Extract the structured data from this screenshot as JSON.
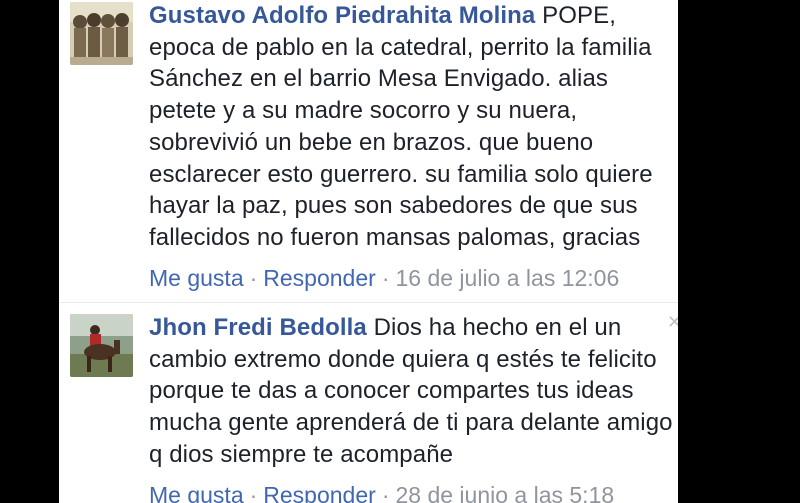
{
  "comments": [
    {
      "author": "Gustavo Adolfo Piedrahita Molina",
      "text": " POPE, epoca de pablo en la catedral, perrito la familia Sánchez en el barrio Mesa Envigado. alias petete y a su madre socorro y su nuera, sobrevivió un bebe en brazos. que bueno esclarecer esto guerrero. su familia solo quiere hayar la paz, pues son sabedores de que sus fallecidos no fueron mansas palomas, gracias",
      "like_label": "Me gusta",
      "reply_label": "Responder",
      "timestamp": "16 de julio a las 12:06"
    },
    {
      "author": "Jhon Fredi Bedolla",
      "text": " Dios ha hecho en el un cambio extremo donde quiera q estés te felicito porque te das a conocer compartes tus ideas mucha gente aprenderá de ti para delante amigo q dios siempre te acompañe",
      "like_label": "Me gusta",
      "reply_label": "Responder",
      "timestamp": "28 de junio a las 5:18"
    }
  ],
  "separator": "·",
  "colors": {
    "author": "#365899",
    "link": "#4267b2",
    "meta": "#90949c",
    "text": "#1d2129"
  },
  "icons": {
    "close": "close-icon"
  }
}
